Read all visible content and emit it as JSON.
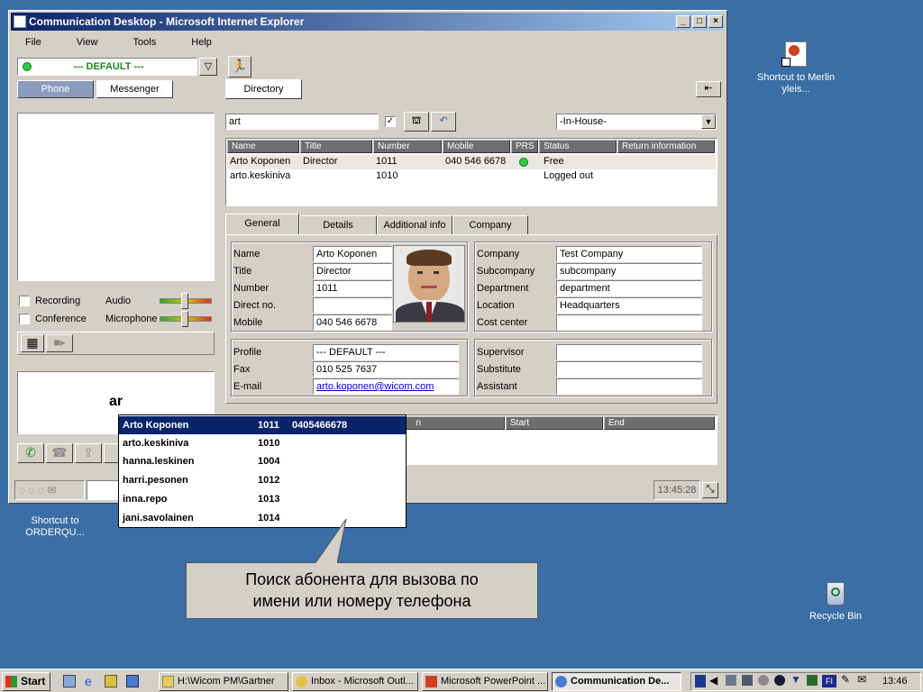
{
  "desktop": {
    "icons": [
      {
        "label": "Shortcut to Merlin yleis..."
      },
      {
        "label": "Shortcut to ORDERQU..."
      },
      {
        "label": "Recycle Bin"
      }
    ]
  },
  "window": {
    "title": "Communication Desktop - Microsoft Internet Explorer",
    "menu": [
      "File",
      "View",
      "Tools",
      "Help"
    ]
  },
  "left": {
    "profile_select": "--- DEFAULT ---",
    "tabs": [
      "Phone",
      "Messenger"
    ],
    "recording_label": "Recording",
    "conference_label": "Conference",
    "audio_label": "Audio",
    "microphone_label": "Microphone",
    "dial_input": "ar",
    "clock": "13:45:28"
  },
  "right": {
    "tab": "Directory",
    "search_value": "art",
    "scope_select": "-In-House-",
    "columns": [
      "Name",
      "Title",
      "Number",
      "Mobile",
      "PRS",
      "Status",
      "Return information"
    ],
    "rows": [
      {
        "name": "Arto Koponen",
        "title": "Director",
        "number": "1011",
        "mobile": "040 546 6678",
        "status": "Free"
      },
      {
        "name": "arto.keskiniva",
        "title": "",
        "number": "1010",
        "mobile": "",
        "status": "Logged out"
      }
    ],
    "detail_tabs": [
      "General",
      "Details",
      "Additional info",
      "Company"
    ],
    "general": {
      "labels": [
        "Name",
        "Title",
        "Number",
        "Direct no.",
        "Mobile"
      ],
      "values": [
        "Arto Koponen",
        "Director",
        "1011",
        "",
        "040 546 6678"
      ]
    },
    "company": {
      "labels": [
        "Company",
        "Subcompany",
        "Department",
        "Location",
        "Cost center"
      ],
      "values": [
        "Test Company",
        "subcompany",
        "department",
        "Headquarters",
        ""
      ]
    },
    "contact": {
      "labels": [
        "Profile",
        "Fax",
        "E-mail"
      ],
      "values": [
        "--- DEFAULT ---",
        "010 525 7637",
        "arto.koponen@wicom.com"
      ]
    },
    "relations": {
      "labels": [
        "Supervisor",
        "Substitute",
        "Assistant"
      ]
    },
    "lower_columns": [
      "n",
      "Start",
      "End"
    ]
  },
  "popup": {
    "rows": [
      {
        "name": "Arto Koponen",
        "number": "1011",
        "mobile": "0405466678"
      },
      {
        "name": "arto.keskiniva",
        "number": "1010",
        "mobile": ""
      },
      {
        "name": "hanna.leskinen",
        "number": "1004",
        "mobile": ""
      },
      {
        "name": "harri.pesonen",
        "number": "1012",
        "mobile": ""
      },
      {
        "name": "inna.repo",
        "number": "1013",
        "mobile": ""
      },
      {
        "name": "jani.savolainen",
        "number": "1014",
        "mobile": ""
      }
    ]
  },
  "callout": {
    "line1": "Поиск абонента для вызова по",
    "line2": "имени или номеру телефона"
  },
  "taskbar": {
    "start": "Start",
    "tasks": [
      "H:\\Wicom PM\\Gartner",
      "Inbox - Microsoft Outl...",
      "Microsoft PowerPoint ...",
      "Communication De..."
    ],
    "clock": "13:46",
    "lang": "FI"
  }
}
